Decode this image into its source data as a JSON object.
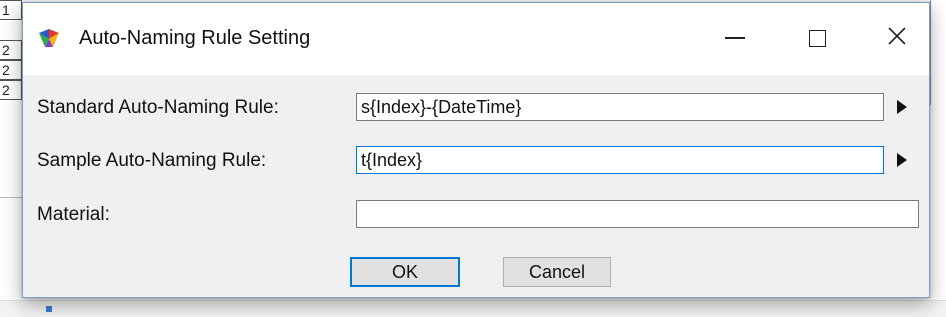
{
  "window": {
    "title": "Auto-Naming Rule Setting"
  },
  "background": {
    "cells": [
      "1",
      "2",
      "2",
      "2"
    ]
  },
  "form": {
    "standard_label": "Standard Auto-Naming Rule:",
    "standard_value": "s{Index}-{DateTime}",
    "sample_label": "Sample Auto-Naming Rule:",
    "sample_value": "t{Index}",
    "material_label": "Material:",
    "material_value": ""
  },
  "buttons": {
    "ok_label": "OK",
    "cancel_label": "Cancel"
  },
  "colors": {
    "focus_border": "#0078d7",
    "dialog_bg": "#f0f0f0",
    "titlebar_bg": "#ffffff"
  },
  "icons": {
    "app": "colorful-feather-icon",
    "minimize": "minimize-icon",
    "maximize": "maximize-icon",
    "close": "close-icon",
    "insert_arrow": "right-triangle-icon"
  }
}
